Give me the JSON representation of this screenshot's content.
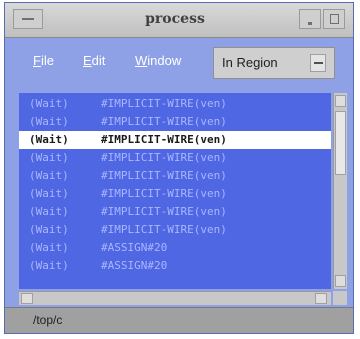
{
  "window": {
    "title": "process"
  },
  "menubar": {
    "file_first": "F",
    "file_rest": "ile",
    "edit_first": "E",
    "edit_rest": "dit",
    "window_first": "W",
    "window_rest": "indow",
    "region_value": "In Region"
  },
  "list": {
    "items": [
      {
        "key": "(Wait)",
        "value": "#IMPLICIT-WIRE(ven)"
      },
      {
        "key": "(Wait)",
        "value": "#IMPLICIT-WIRE(ven)"
      },
      {
        "key": "(Wait)",
        "value": "#IMPLICIT-WIRE(ven)"
      },
      {
        "key": "(Wait)",
        "value": "#IMPLICIT-WIRE(ven)"
      },
      {
        "key": "(Wait)",
        "value": "#IMPLICIT-WIRE(ven)"
      },
      {
        "key": "(Wait)",
        "value": "#IMPLICIT-WIRE(ven)"
      },
      {
        "key": "(Wait)",
        "value": "#IMPLICIT-WIRE(ven)"
      },
      {
        "key": "(Wait)",
        "value": "#IMPLICIT-WIRE(ven)"
      },
      {
        "key": "(Wait)",
        "value": "#ASSIGN#20"
      },
      {
        "key": "(Wait)",
        "value": "#ASSIGN#20"
      }
    ],
    "selected_index": 2
  },
  "status": {
    "path": "/top/c"
  },
  "colors": {
    "window_bg": "#8ea0e6",
    "list_bg": "#4f67e2",
    "list_text": "#a9b6ff",
    "selected_bg": "#ffffff"
  }
}
